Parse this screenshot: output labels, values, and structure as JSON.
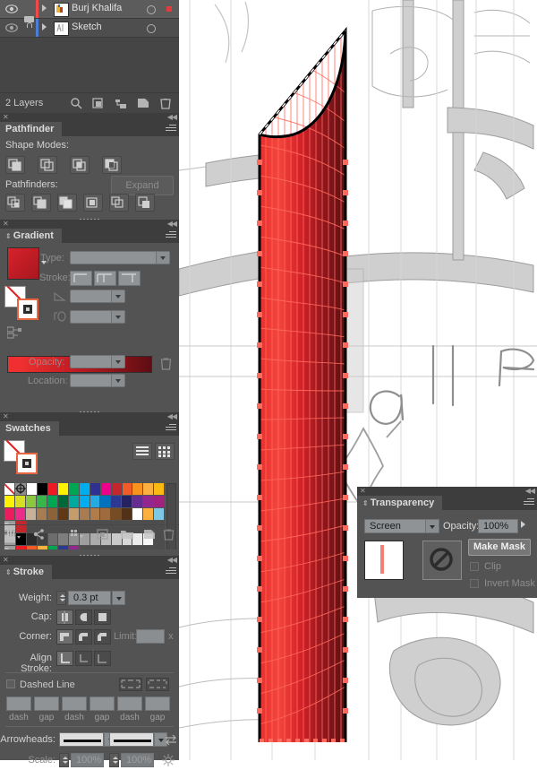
{
  "app": {
    "theme_bg": "#535353",
    "accent_red": "#e23b3b"
  },
  "layers_panel": {
    "title": "",
    "rows": [
      {
        "name": "Burj Khalifa",
        "color": "#f04a4a",
        "visible": true,
        "locked": false,
        "selected": true,
        "has_target": true,
        "has_selection_square": true
      },
      {
        "name": "Sketch",
        "color": "#4a7fd4",
        "visible": true,
        "locked": true,
        "selected": false,
        "has_target": true,
        "has_selection_square": false
      }
    ],
    "footer_count": "2 Layers",
    "footer_icons": [
      "locate-object-icon",
      "make-clipping-mask-icon",
      "create-new-sublayer-icon",
      "create-new-layer-icon",
      "delete-selection-icon"
    ]
  },
  "pathfinder_panel": {
    "tab": "Pathfinder",
    "shape_modes_label": "Shape Modes:",
    "shape_mode_buttons": [
      "unite-icon",
      "minus-front-icon",
      "intersect-icon",
      "exclude-icon"
    ],
    "expand_label": "Expand",
    "pathfinders_label": "Pathfinders:",
    "pathfinder_buttons": [
      "divide-icon",
      "trim-icon",
      "merge-icon",
      "crop-icon",
      "outline-icon",
      "minus-back-icon"
    ]
  },
  "gradient_panel": {
    "tab": "Gradient",
    "swatch_color": "#c51f29",
    "type_label": "Type:",
    "type_value": "",
    "stroke_label": "Stroke:",
    "stroke_buttons": [
      "stroke-within-icon",
      "stroke-along-icon",
      "stroke-across-icon"
    ],
    "angle_value": "",
    "aspect_value": "",
    "opacity_label": "Opacity:",
    "opacity_value": "",
    "location_label": "Location:",
    "location_value": "",
    "gradient_start": "#f03030",
    "gradient_end": "#5e0d12",
    "delete_stop_icon": "trash-icon"
  },
  "swatches_panel": {
    "tab": "Swatches",
    "view_buttons": [
      "list-view-icon",
      "grid-view-icon"
    ],
    "grid": [
      [
        "none",
        "registration",
        "#ffffff",
        "#000000",
        "#ed1c24",
        "#fff200",
        "#00a651",
        "#00aeef",
        "#2e3192",
        "#ec008c",
        "#c1272d",
        "#f15a29",
        "#f7931e",
        "#fbb040",
        "#fdb913"
      ],
      [
        "#fff200",
        "#d7df23",
        "#8dc63f",
        "#39b54a",
        "#00a651",
        "#006838",
        "#00a99d",
        "#00aeef",
        "#27aae1",
        "#0072bc",
        "#2b3990",
        "#262262",
        "#662d91",
        "#92278f",
        "#a0227f"
      ],
      [
        "#ec1c5e",
        "#ed2c8a",
        "#c7b299",
        "#a67c52",
        "#8c6239",
        "#603813",
        "#c69c6d",
        "#a97c50",
        "#b07d4a",
        "#9e6b3f",
        "#754c24",
        "#523119",
        "#ffffff",
        "#fbb040",
        "#7ec8e3"
      ],
      [
        "swatch-group-icon",
        "#c1272d",
        "",
        "",
        "",
        "",
        "",
        "",
        "",
        "",
        "",
        "",
        "",
        "",
        ""
      ],
      [
        "folder-icon",
        "#000000",
        "#2b2b2b",
        "#414141",
        "#6d6d6d",
        "#7e7e7e",
        "#8e8e8e",
        "#9e9e9e",
        "#ababab",
        "#bcbcbc",
        "#cacaca",
        "#d9d9d9",
        "#ebebeb",
        "#f7f7f7",
        ""
      ],
      [
        "folder-icon",
        "#ed1c24",
        "#f15a29",
        "#fbb040",
        "#00a651",
        "#2b3990",
        "#92278f",
        "",
        "",
        "",
        "",
        "",
        "",
        "",
        ""
      ]
    ],
    "footer_icons": [
      "swatch-libraries-icon",
      "show-kuler-icon",
      "swatch-options-icon",
      "new-color-group-icon",
      "folder-icon",
      "new-swatch-icon",
      "delete-swatch-icon"
    ]
  },
  "stroke_panel": {
    "tab": "Stroke",
    "weight_label": "Weight:",
    "weight_value": "0.3 pt",
    "cap_label": "Cap:",
    "cap_buttons": [
      "butt-cap-icon",
      "round-cap-icon",
      "projecting-cap-icon"
    ],
    "cap_selected": 0,
    "corner_label": "Corner:",
    "corner_buttons": [
      "miter-join-icon",
      "round-join-icon",
      "bevel-join-icon"
    ],
    "corner_selected": 0,
    "limit_label": "Limit:",
    "limit_value": "",
    "limit_unit": "x",
    "align_stroke_label": "Align Stroke:",
    "align_buttons": [
      "align-center-icon",
      "align-inside-icon",
      "align-outside-icon"
    ],
    "align_selected": 0,
    "dashed_line_label": "Dashed Line",
    "dashed_checked": false,
    "dash_preserve_buttons": [
      "dash-preserve-exact-icon",
      "dash-adjust-corners-icon"
    ],
    "dash_fields": [
      "",
      "",
      "",
      "",
      "",
      ""
    ],
    "dash_labels": [
      "dash",
      "gap",
      "dash",
      "gap",
      "dash",
      "gap"
    ],
    "arrowheads_label": "Arrowheads:",
    "arrowhead_start": "",
    "arrowhead_end": "",
    "swap_arrowheads_icon": "swap-arrowheads-icon",
    "scale_label": "Scale:",
    "scale_start": "100%",
    "scale_end": "100%",
    "link_scale_icon": "link-scale-icon"
  },
  "transparency_panel": {
    "tab": "Transparency",
    "blend_mode": "Screen",
    "opacity_label": "Opacity:",
    "opacity_value": "100%",
    "make_mask_label": "Make Mask",
    "clip_label": "Clip",
    "clip_checked": false,
    "invert_mask_label": "Invert Mask",
    "invert_checked": false,
    "thumbnail_icon": "artwork-thumbnail",
    "mask_icon": "no-mask-icon"
  },
  "canvas": {
    "artwork_name": "Burj Khalifa tower wing",
    "background": "#ffffff",
    "sketch_description": "grey pencil architectural sketch of tower plan",
    "shape_fill_start": "#f4312f",
    "shape_fill_end": "#5b1014",
    "mesh_line_color": "#ff6a5e",
    "anchor_color": "#ff6a5e",
    "path_stroke": "#000000"
  }
}
